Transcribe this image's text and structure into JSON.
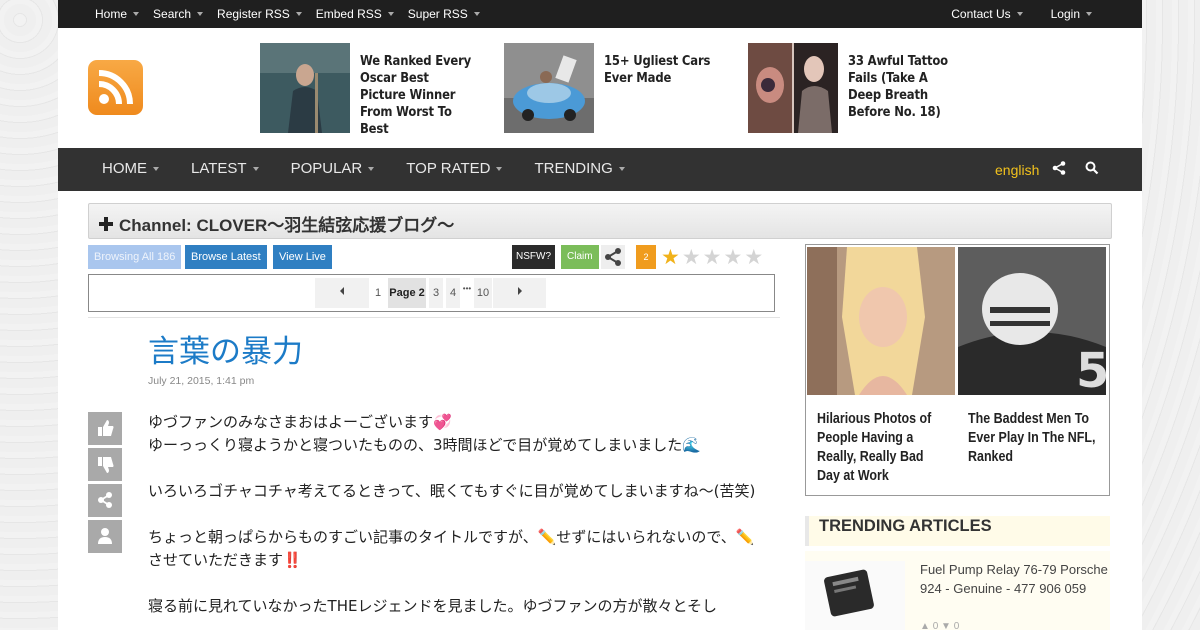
{
  "topbar": {
    "left_items": [
      "Home",
      "Search",
      "Register RSS",
      "Embed RSS",
      "Super RSS"
    ],
    "right_items": [
      "Contact Us",
      "Login"
    ]
  },
  "header": {
    "logo_icon": "rss-icon",
    "promos": [
      {
        "title": "We Ranked Every Oscar Best Picture Winner From Worst To Best"
      },
      {
        "title": "15+ Ugliest Cars Ever Made"
      },
      {
        "title": "33 Awful Tattoo Fails (Take A Deep Breath Before No. 18)"
      }
    ]
  },
  "mainnav": {
    "items": [
      "HOME",
      "LATEST",
      "POPULAR",
      "TOP RATED",
      "TRENDING"
    ],
    "language": "english"
  },
  "channel": {
    "title": "Channel: CLOVER～羽生結弦応援ブログ～"
  },
  "toolbar": {
    "browsing_all": "Browsing All 186",
    "browse_latest": "Browse Latest",
    "view_live": "View Live",
    "nsfw": "NSFW?",
    "claim": "Claim",
    "count": "2",
    "rating": 1,
    "rating_max": 5
  },
  "pager": {
    "prev_icon": "chevron-left-icon",
    "next_icon": "chevron-right-icon",
    "pages": [
      "1",
      "Page 2",
      "3",
      "4",
      "10"
    ],
    "ellipsis": "•••"
  },
  "post": {
    "title": "言葉の暴力",
    "date": "July 21, 2015, 1:41 pm",
    "paragraphs": [
      "ゆづファンのみなさまおはよーございます💞\nゆーっっくり寝ようかと寝ついたものの、3時間ほどで目が覚めてしまいました🌊",
      "いろいろゴチャコチャ考えてるときって、眠くてもすぐに目が覚めてしまいますね～(苦笑)",
      "ちょっと朝っぱらからものすごい記事のタイトルですが、✏️せずにはいられないので、✏️させていただきます‼️",
      "寝る前に見れていなかったTHEレジェンドを見ました。ゆづファンの方が散々とそし"
    ]
  },
  "ads": [
    {
      "title": "Hilarious Photos of People Having a Really, Really Bad Day at Work"
    },
    {
      "title": "The Baddest Men To Ever Play In The NFL, Ranked"
    }
  ],
  "trending": {
    "heading": "TRENDING ARTICLES",
    "items": [
      {
        "title": "Fuel Pump Relay 76-79 Porsche 924 - Genuine - 477 906 059",
        "likes": "0",
        "dislikes": "0"
      }
    ]
  }
}
